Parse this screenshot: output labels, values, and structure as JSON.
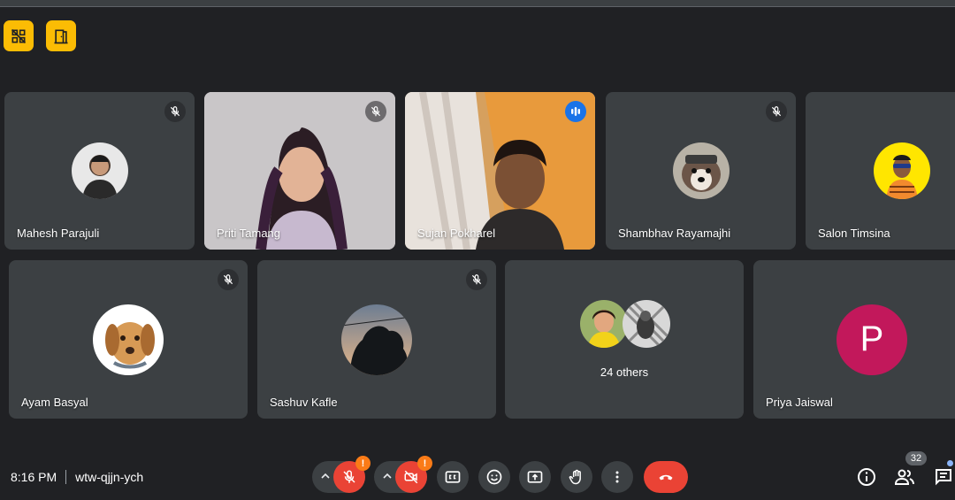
{
  "meeting": {
    "time": "8:16 PM",
    "code": "wtw-qjjn-ych"
  },
  "participants_row1": [
    {
      "name": "Mahesh Parajuli",
      "muted": true,
      "kind": "avatar"
    },
    {
      "name": "Priti Tamang",
      "muted": true,
      "kind": "video"
    },
    {
      "name": "Sujan Pokharel",
      "muted": false,
      "speaking": true,
      "kind": "video"
    },
    {
      "name": "Shambhav Rayamajhi",
      "muted": true,
      "kind": "avatar"
    },
    {
      "name": "Salon Timsina",
      "muted": false,
      "kind": "avatar"
    }
  ],
  "participants_row2": [
    {
      "name": "Ayam Basyal",
      "muted": true,
      "kind": "avatar"
    },
    {
      "name": "Sashuv Kafle",
      "muted": true,
      "kind": "avatar"
    },
    {
      "name": "",
      "kind": "others",
      "others_label": "24 others"
    },
    {
      "name": "Priya Jaiswal",
      "kind": "letter",
      "letter": "P",
      "letter_color": "#c2185b"
    }
  ],
  "controls": {
    "participants_count": "32",
    "mic_warning": "!",
    "cam_warning": "!"
  },
  "icons": {
    "host_left": "grid-off-icon",
    "host_right": "door-icon",
    "mute": "mic-off-icon",
    "speak": "audio-levels-icon",
    "captions": "closed-captions-icon",
    "reactions": "emoji-icon",
    "present": "present-screen-icon",
    "raise_hand": "hand-icon",
    "more": "more-vert-icon",
    "end_call": "call-end-icon",
    "info": "info-icon",
    "people": "people-icon",
    "chat": "chat-icon"
  },
  "colors": {
    "background": "#202124",
    "tile": "#3c4043",
    "host_controls": "#fbbc04",
    "end_call": "#ea4335",
    "speaking_outline": "#8ab4f8",
    "warning": "#fa7b17"
  }
}
